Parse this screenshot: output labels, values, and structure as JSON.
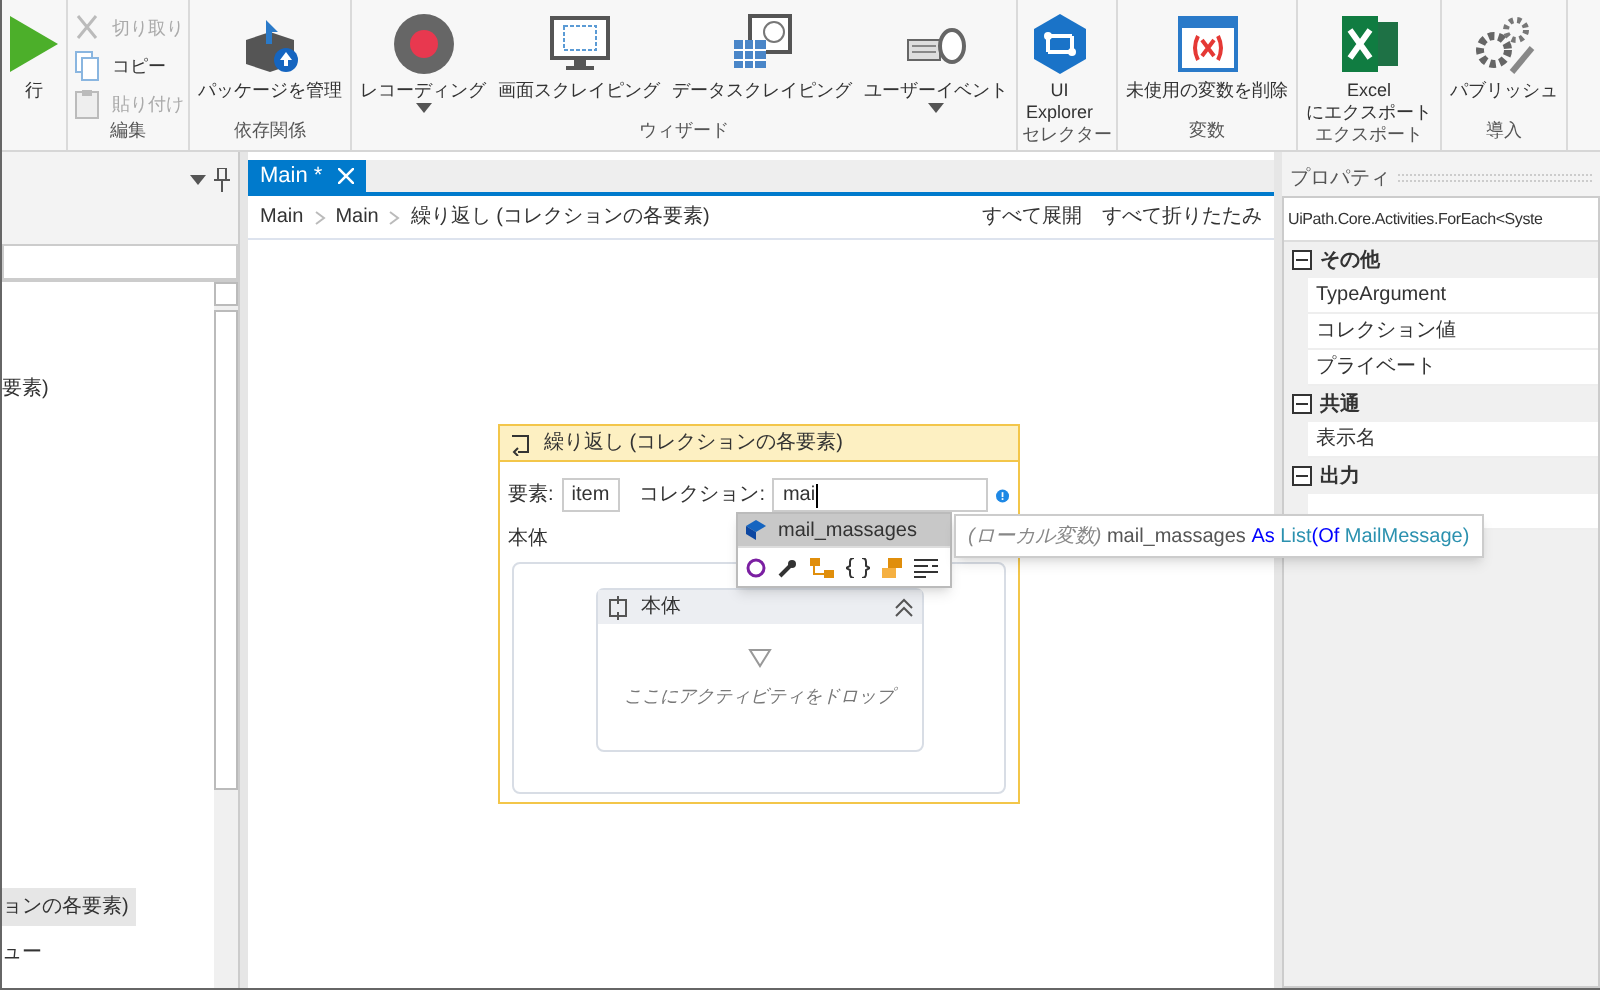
{
  "ribbon": {
    "groups": [
      {
        "items": [
          {
            "label": "行",
            "kind": "large",
            "dropdown": false,
            "disabled": false
          }
        ]
      },
      {
        "label": "編集",
        "items": [
          {
            "label": "切り取り",
            "kind": "small",
            "dropdown": false,
            "disabled": true
          },
          {
            "label": "コピー",
            "kind": "small",
            "dropdown": false,
            "disabled": false
          },
          {
            "label": "貼り付け",
            "kind": "small",
            "dropdown": false,
            "disabled": true
          }
        ]
      },
      {
        "label": "依存関係",
        "items": [
          {
            "label": "パッケージを管理",
            "kind": "large",
            "dropdown": false,
            "disabled": false
          }
        ]
      },
      {
        "label": "ウィザード",
        "items": [
          {
            "label": "レコーディング",
            "kind": "large",
            "dropdown": true,
            "disabled": false
          },
          {
            "label": "画面スクレイピング",
            "kind": "large",
            "dropdown": false,
            "disabled": false
          },
          {
            "label": "データスクレイピング",
            "kind": "large",
            "dropdown": false,
            "disabled": false
          },
          {
            "label": "ユーザーイベント",
            "kind": "large",
            "dropdown": true,
            "disabled": false
          }
        ]
      },
      {
        "label": "セレクター",
        "items": [
          {
            "label": "UI\nExplorer",
            "kind": "large",
            "dropdown": false,
            "disabled": false
          }
        ]
      },
      {
        "label": "変数",
        "items": [
          {
            "label": "未使用の変数を削除",
            "kind": "large",
            "dropdown": false,
            "disabled": false
          }
        ]
      },
      {
        "label": "エクスポート",
        "items": [
          {
            "label": "Excel\nにエクスポート",
            "kind": "large",
            "dropdown": false,
            "disabled": false
          }
        ]
      },
      {
        "label": "導入",
        "items": [
          {
            "label": "パブリッシュ",
            "kind": "large",
            "dropdown": false,
            "disabled": false
          }
        ]
      }
    ]
  },
  "left_panel": {
    "tree_items": [
      {
        "label": "要素)",
        "selected": false
      },
      {
        "label": "ョンの各要素)",
        "selected": true
      },
      {
        "label": "ュー",
        "selected": false
      }
    ]
  },
  "designer": {
    "tabs": [
      {
        "label": "Main *",
        "selected": true
      }
    ],
    "breadcrumb": [
      "Main",
      "Main",
      "繰り返し (コレクションの各要素)"
    ],
    "actions": [
      "すべて展開",
      "すべて折りたたみ"
    ],
    "activity": {
      "title": "繰り返し (コレクションの各要素)",
      "item_label": "要素:",
      "item_value": "item",
      "collection_label": "コレクション:",
      "collection_value": "mai",
      "warning": true,
      "body_label": "本体",
      "body": {
        "title": "本体",
        "expanded": true,
        "drop_hint": "ここにアクティビティをドロップ"
      }
    },
    "autocomplete": {
      "items": [
        {
          "label": "mail_massages",
          "selected": true
        }
      ]
    },
    "tooltip": {
      "kind_text": "(ローカル変数)",
      "name": "mail_massages",
      "keyword": "As",
      "type": "List",
      "of": "(Of",
      "type_arg": "MailMessage)"
    }
  },
  "properties": {
    "title": "プロパティ",
    "type_name": "UiPath.Core.Activities.ForEach<Syste",
    "categories": [
      {
        "name": "その他",
        "expanded": true,
        "rows": [
          "TypeArgument",
          "コレクション値",
          "プライベート"
        ]
      },
      {
        "name": "共通",
        "expanded": true,
        "rows": [
          "表示名"
        ]
      },
      {
        "name": "出力",
        "expanded": true,
        "rows": [
          ""
        ]
      }
    ]
  }
}
